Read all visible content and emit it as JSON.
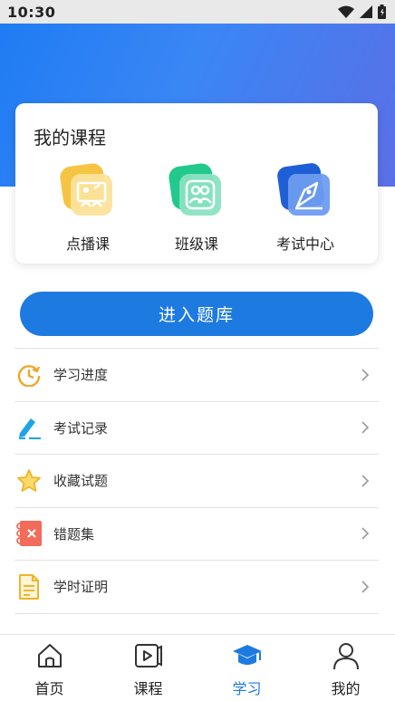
{
  "status_bar": {
    "time": "10:30"
  },
  "my_courses": {
    "title": "我的课程",
    "items": [
      {
        "label": "点播课",
        "icon": "presentation-icon"
      },
      {
        "label": "班级课",
        "icon": "group-icon"
      },
      {
        "label": "考试中心",
        "icon": "pen-nib-icon"
      }
    ]
  },
  "enter_button": {
    "label": "进入题库"
  },
  "menu": [
    {
      "label": "学习进度",
      "icon": "progress-clock-icon"
    },
    {
      "label": "考试记录",
      "icon": "pencil-record-icon"
    },
    {
      "label": "收藏试题",
      "icon": "star-icon"
    },
    {
      "label": "错题集",
      "icon": "notebook-x-icon"
    },
    {
      "label": "学时证明",
      "icon": "document-icon"
    }
  ],
  "tabbar": [
    {
      "label": "首页",
      "icon": "home-icon",
      "active": false
    },
    {
      "label": "课程",
      "icon": "video-icon",
      "active": false
    },
    {
      "label": "学习",
      "icon": "graduation-cap-icon",
      "active": true
    },
    {
      "label": "我的",
      "icon": "person-icon",
      "active": false
    }
  ],
  "colors": {
    "accent": "#1d7ae0",
    "hero_start": "#1f7cf3",
    "hero_end": "#5b6fe6"
  }
}
